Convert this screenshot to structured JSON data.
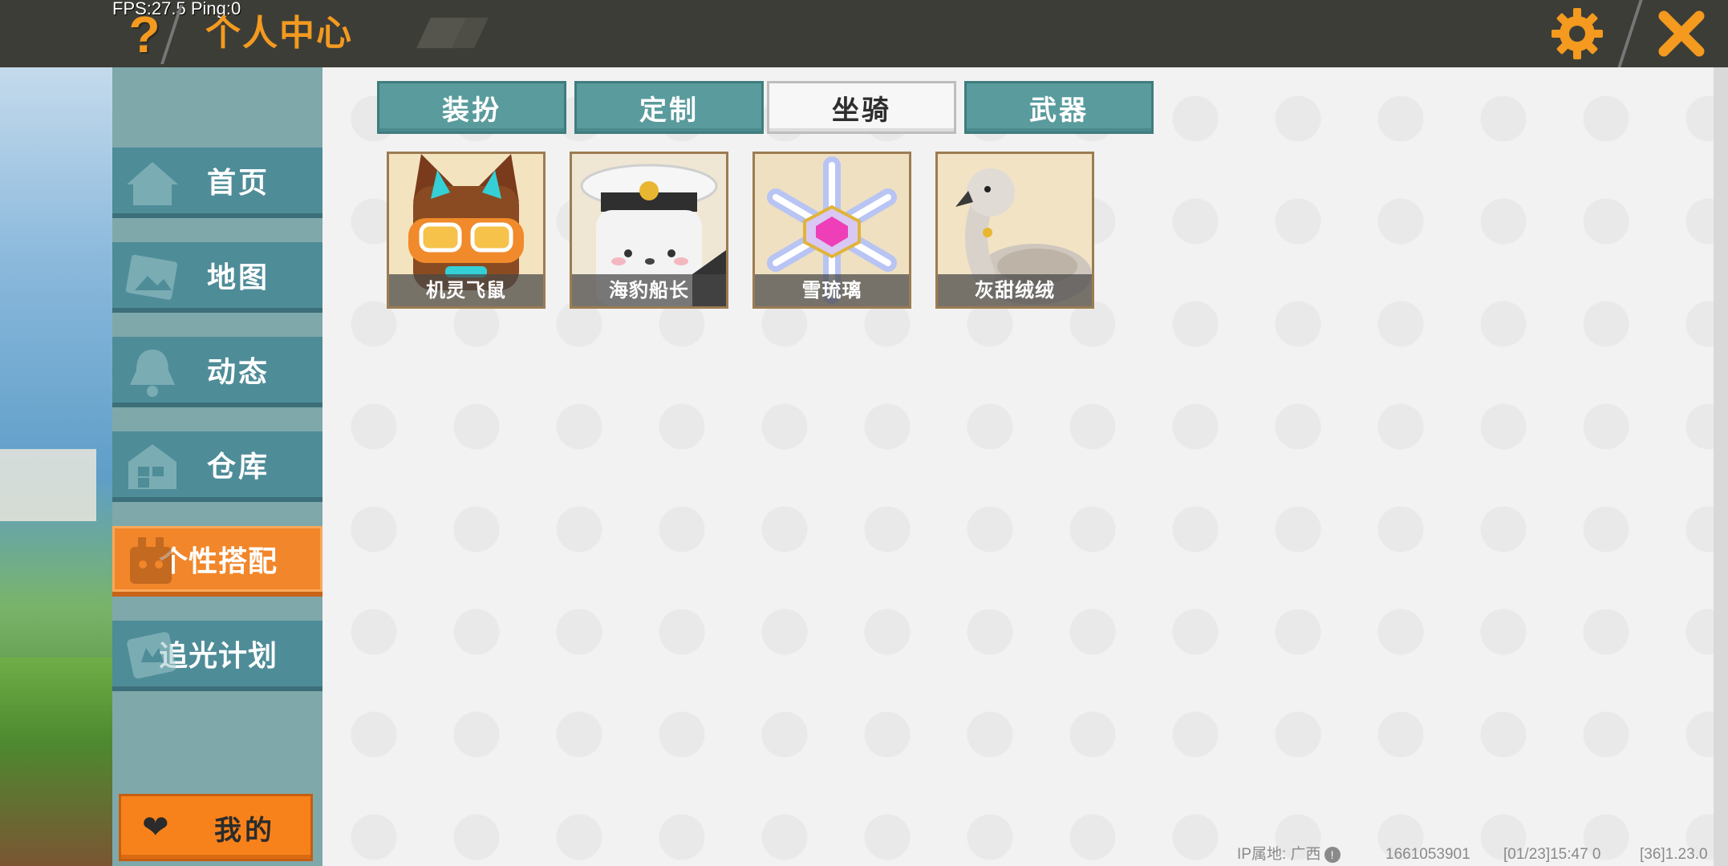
{
  "topbar": {
    "fps_text": "FPS:27.5  Ping:0",
    "help_symbol": "?",
    "title": "个人中心",
    "settings_icon": "gear-icon",
    "close_icon": "close-icon",
    "accent_color": "#f39a1f"
  },
  "sidebar": {
    "items": [
      {
        "label": "首页",
        "icon": "home-icon"
      },
      {
        "label": "地图",
        "icon": "map-icon"
      },
      {
        "label": "动态",
        "icon": "bell-icon"
      },
      {
        "label": "仓库",
        "icon": "warehouse-icon"
      },
      {
        "label": "个性搭配",
        "icon": "outfit-icon",
        "active": true
      },
      {
        "label": "追光计划",
        "icon": "chase-light-icon"
      }
    ],
    "mine_button": {
      "label": "我的",
      "icon": "heart-icon"
    }
  },
  "tabs": [
    {
      "label": "装扮"
    },
    {
      "label": "定制"
    },
    {
      "label": "坐骑",
      "active": true
    },
    {
      "label": "武器"
    }
  ],
  "items": [
    {
      "label": "机灵飞鼠",
      "icon": "flying-squirrel-mount-icon"
    },
    {
      "label": "海豹船长",
      "icon": "seal-captain-mount-icon"
    },
    {
      "label": "雪琉璃",
      "icon": "snow-glaze-mount-icon"
    },
    {
      "label": "灰甜绒绒",
      "icon": "grey-fluffy-mount-icon"
    }
  ],
  "footer": {
    "ip_location": "IP属地: 广西",
    "uid": "1661053901",
    "timestamp": "[01/23]15:47 0",
    "version": "[36]1.23.0"
  }
}
